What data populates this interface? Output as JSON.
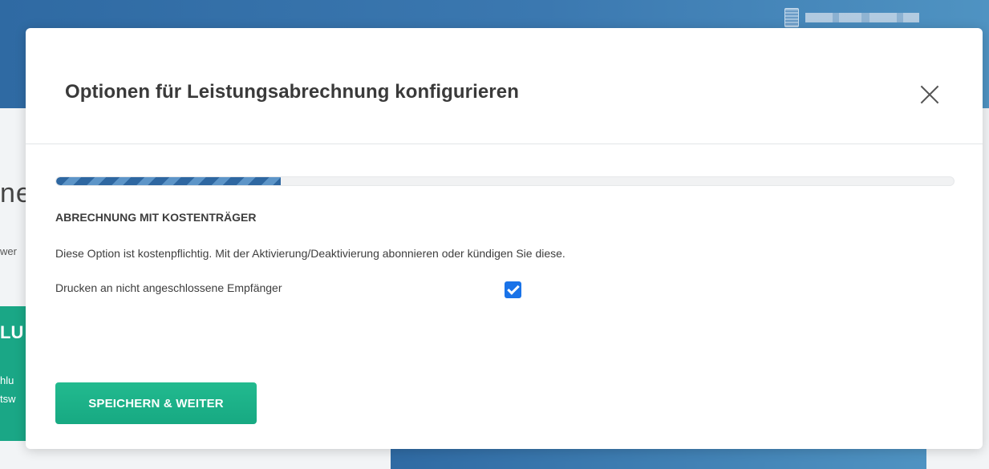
{
  "background": {
    "heading_fragment": "ne",
    "text_fragment": "wer",
    "card": {
      "title_fragment": "LU",
      "line1_fragment": "hlu",
      "line2_fragment": "tsw"
    }
  },
  "modal": {
    "title": "Optionen für Leistungsabrechnung konfigurieren",
    "close_icon": "close-icon",
    "progress": {
      "value_percent": 25
    },
    "section_heading": "ABRECHNUNG MIT KOSTENTRÄGER",
    "description": "Diese Option ist kostenpflichtig. Mit der Aktivierung/Deaktivierung abonnieren oder kündigen Sie diese.",
    "option": {
      "label": "Drucken an nicht angeschlossene Empfänger",
      "checked": true
    },
    "save_button_label": "SPEICHERN & WEITER"
  },
  "colors": {
    "header_blue": "#2f6aa3",
    "accent_green": "#1aa786",
    "checkbox_blue": "#1a73e8"
  }
}
